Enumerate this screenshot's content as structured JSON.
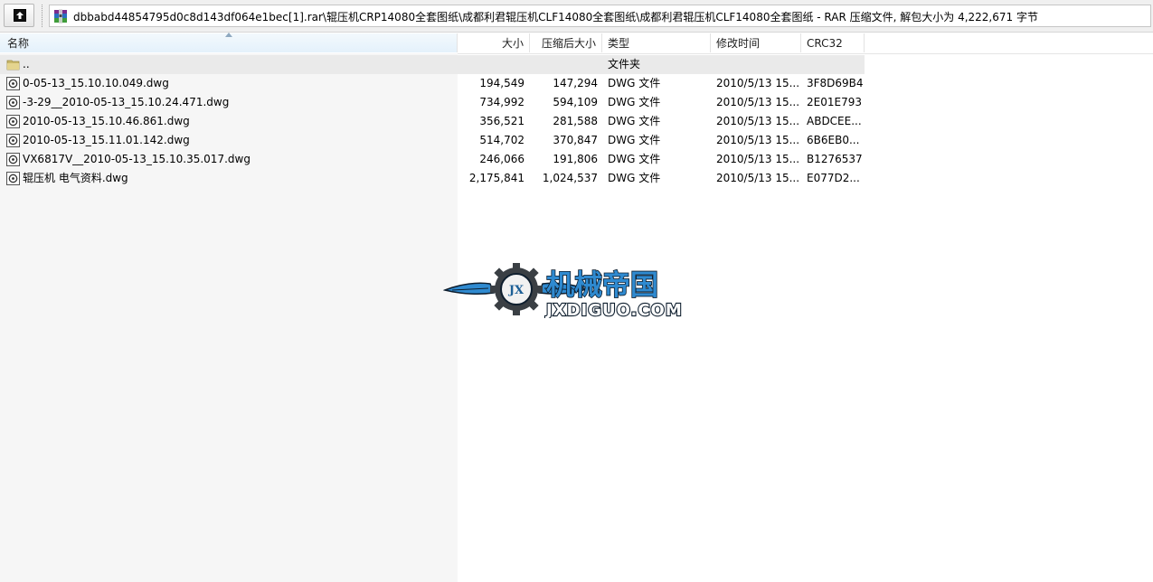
{
  "pathbar": {
    "up_icon": "up-arrow-icon",
    "archive_icon": "winrar-archive-icon",
    "path": "dbbabd44854795d0c8d143df064e1bec[1].rar\\辊压机CRP14080全套图纸\\成都利君辊压机CLF14080全套图纸\\成都利君辊压机CLF14080全套图纸 - RAR 压缩文件, 解包大小为 4,222,671 字节"
  },
  "columns": {
    "name": "名称",
    "size": "大小",
    "packed": "压缩后大小",
    "type": "类型",
    "modified": "修改时间",
    "crc": "CRC32"
  },
  "rows": [
    {
      "icon": "folder-icon",
      "name": "..",
      "size": "",
      "packed": "",
      "type": "文件夹",
      "modified": "",
      "crc": ""
    },
    {
      "icon": "dwg-file-icon",
      "name": "0-05-13_15.10.10.049.dwg",
      "size": "194,549",
      "packed": "147,294",
      "type": "DWG 文件",
      "modified": "2010/5/13 15...",
      "crc": "3F8D69B4"
    },
    {
      "icon": "dwg-file-icon",
      "name": "-3-29__2010-05-13_15.10.24.471.dwg",
      "size": "734,992",
      "packed": "594,109",
      "type": "DWG 文件",
      "modified": "2010/5/13 15...",
      "crc": "2E01E793"
    },
    {
      "icon": "dwg-file-icon",
      "name": "2010-05-13_15.10.46.861.dwg",
      "size": "356,521",
      "packed": "281,588",
      "type": "DWG 文件",
      "modified": "2010/5/13 15...",
      "crc": "ABDCEE..."
    },
    {
      "icon": "dwg-file-icon",
      "name": "2010-05-13_15.11.01.142.dwg",
      "size": "514,702",
      "packed": "370,847",
      "type": "DWG 文件",
      "modified": "2010/5/13 15...",
      "crc": "6B6EB0..."
    },
    {
      "icon": "dwg-file-icon",
      "name": "VX6817V__2010-05-13_15.10.35.017.dwg",
      "size": "246,066",
      "packed": "191,806",
      "type": "DWG 文件",
      "modified": "2010/5/13 15...",
      "crc": "B1276537"
    },
    {
      "icon": "dwg-file-icon",
      "name": "辊压机 电气资料.dwg",
      "size": "2,175,841",
      "packed": "1,024,537",
      "type": "DWG 文件",
      "modified": "2010/5/13 15...",
      "crc": "E077D2..."
    }
  ],
  "watermark": {
    "emblem_text": "JX",
    "title": "机械帝国",
    "site": "JXDIGUO.COM",
    "colors": {
      "primary": "#2f8ad0",
      "dark": "#0e1e2e",
      "gear": "#3a3f44"
    }
  }
}
